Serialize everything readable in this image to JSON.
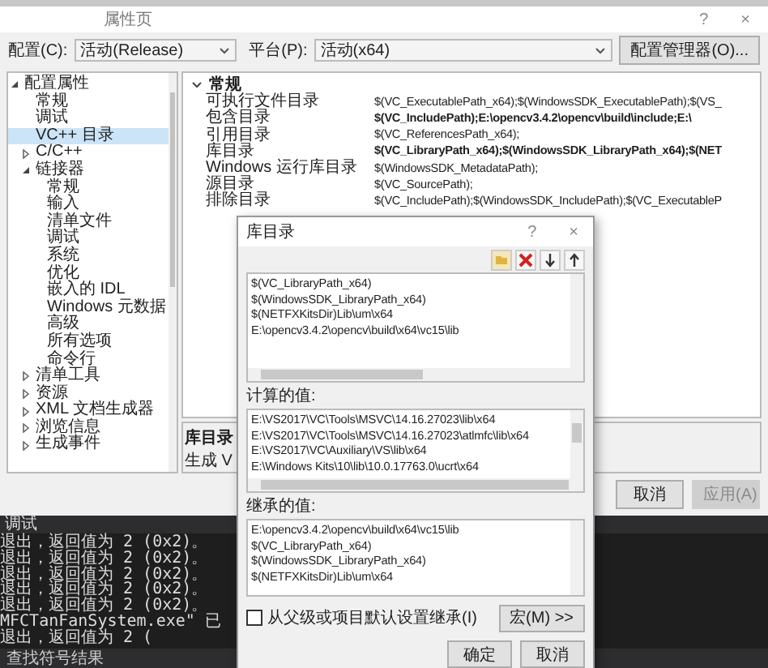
{
  "window": {
    "title": "属性页",
    "help": "?",
    "close": "×"
  },
  "config": {
    "config_label": "配置(C):",
    "config_value": "活动(Release)",
    "platform_label": "平台(P):",
    "platform_value": "活动(x64)",
    "manager_button": "配置管理器(O)..."
  },
  "tree": {
    "items": [
      {
        "label": "配置属性",
        "expanded": true,
        "selected": false,
        "children": [
          {
            "label": "常规",
            "selected": false
          },
          {
            "label": "调试",
            "selected": false
          },
          {
            "label": "VC++ 目录",
            "selected": true
          },
          {
            "label": "C/C++",
            "expanded": false,
            "selected": false
          },
          {
            "label": "链接器",
            "expanded": true,
            "selected": false,
            "children": [
              {
                "label": "常规",
                "selected": false
              },
              {
                "label": "输入",
                "selected": false
              },
              {
                "label": "清单文件",
                "selected": false
              },
              {
                "label": "调试",
                "selected": false
              },
              {
                "label": "系统",
                "selected": false
              },
              {
                "label": "优化",
                "selected": false
              },
              {
                "label": "嵌入的 IDL",
                "selected": false
              },
              {
                "label": "Windows 元数据",
                "selected": false
              },
              {
                "label": "高级",
                "selected": false
              },
              {
                "label": "所有选项",
                "selected": false
              },
              {
                "label": "命令行",
                "selected": false
              }
            ]
          },
          {
            "label": "清单工具",
            "expanded": false,
            "selected": false
          },
          {
            "label": "资源",
            "expanded": false,
            "selected": false
          },
          {
            "label": "XML 文档生成器",
            "expanded": false,
            "selected": false
          },
          {
            "label": "浏览信息",
            "expanded": false,
            "selected": false
          },
          {
            "label": "生成事件",
            "expanded": false,
            "selected": false
          }
        ]
      }
    ]
  },
  "grid": {
    "section": {
      "label": "常规",
      "expanded": true
    },
    "rows": [
      {
        "name": "可执行文件目录",
        "value": "$(VC_ExecutablePath_x64);$(WindowsSDK_ExecutablePath);$(VS_",
        "bold": false
      },
      {
        "name": "包含目录",
        "value": "$(VC_IncludePath);E:\\opencv3.4.2\\opencv\\build\\include;E:\\",
        "bold": true
      },
      {
        "name": "引用目录",
        "value": "$(VC_ReferencesPath_x64);",
        "bold": false
      },
      {
        "name": "库目录",
        "value": "$(VC_LibraryPath_x64);$(WindowsSDK_LibraryPath_x64);$(NET",
        "bold": true
      },
      {
        "name": "Windows 运行库目录",
        "value": "$(WindowsSDK_MetadataPath);",
        "bold": false
      },
      {
        "name": "源目录",
        "value": "$(VC_SourcePath);",
        "bold": false
      },
      {
        "name": "排除目录",
        "value": "$(VC_IncludePath);$(WindowsSDK_IncludePath);$(VC_ExecutableP",
        "bold": false
      }
    ]
  },
  "description": {
    "title": "库目录",
    "text": "生成 V"
  },
  "buttons": [
    {
      "label": "取消",
      "disabled": false
    },
    {
      "label": "应用(A)",
      "disabled": true
    }
  ],
  "output": {
    "title": "调试",
    "lines": [
      "退出，返回值为 2 (0x2)。",
      "退出，返回值为 2 (0x2)。",
      "退出，返回值为 2 (0x2)。",
      "退出，返回值为 2 (0x2)。",
      "退出，返回值为 2 (0x2)。",
      "MFCTanFanSystem.exe\" 已退出，返回值为 2 ("
    ]
  },
  "bottom_tab": "查找符号结果",
  "dialog": {
    "title": "库目录",
    "help": "?",
    "close": "×",
    "entries": [
      "$(VC_LibraryPath_x64)",
      "$(WindowsSDK_LibraryPath_x64)",
      "$(NETFXKitsDir)Lib\\um\\x64",
      "E:\\opencv3.4.2\\opencv\\build\\x64\\vc15\\lib"
    ],
    "evaluated_label": "计算的值:",
    "evaluated": [
      "E:\\VS2017\\VC\\Tools\\MSVC\\14.16.27023\\lib\\x64",
      "E:\\VS2017\\VC\\Tools\\MSVC\\14.16.27023\\atlmfc\\lib\\x64",
      "E:\\VS2017\\VC\\Auxiliary\\VS\\lib\\x64",
      "E:\\Windows Kits\\10\\lib\\10.0.17763.0\\ucrt\\x64"
    ],
    "inherited_label": "继承的值:",
    "inherited": [
      "E:\\opencv3.4.2\\opencv\\build\\x64\\vc15\\lib",
      "$(VC_LibraryPath_x64)",
      "$(WindowsSDK_LibraryPath_x64)",
      "$(NETFXKitsDir)Lib\\um\\x64"
    ],
    "inherit_checkbox": {
      "label": "从父级或项目默认设置继承(I)",
      "checked": false
    },
    "macro_button": "宏(M) >>",
    "ok_button": "确定",
    "cancel_button": "取消"
  }
}
